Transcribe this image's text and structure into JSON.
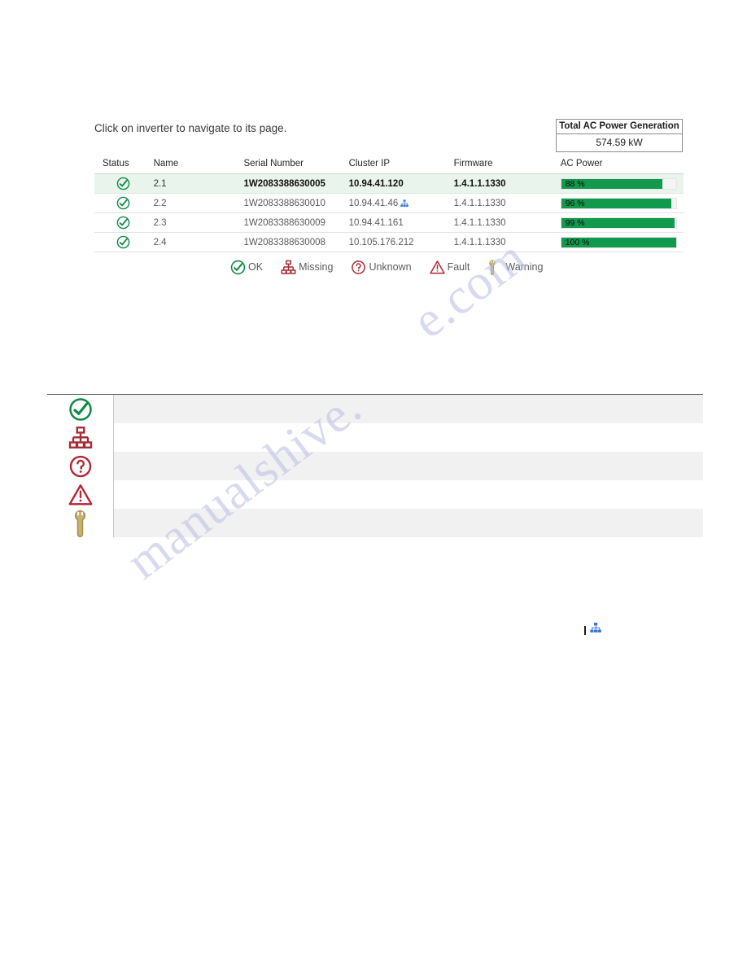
{
  "page": {
    "intro_text": "Click on inverter to navigate to its page.",
    "watermark_a": "manualshive.",
    "watermark_b": "e.com"
  },
  "total_panel": {
    "title": "Total AC Power Generation",
    "value": "574.59 kW"
  },
  "inverter_table": {
    "columns": [
      {
        "key": "status",
        "label": "Status"
      },
      {
        "key": "name",
        "label": "Name"
      },
      {
        "key": "serial",
        "label": "Serial Number"
      },
      {
        "key": "cluster_ip",
        "label": "Cluster IP"
      },
      {
        "key": "firmware",
        "label": "Firmware"
      },
      {
        "key": "ac_power",
        "label": "AC Power"
      }
    ],
    "rows": [
      {
        "status_icon": "ok-check-icon",
        "name": "2.1",
        "serial": "1W2083388630005",
        "cluster_ip": "10.94.41.120",
        "has_cluster_icon": false,
        "firmware": "1.4.1.1.1330",
        "ac_power_label": "88 %",
        "ac_power_percent": 88,
        "selected": true
      },
      {
        "status_icon": "ok-check-icon",
        "name": "2.2",
        "serial": "1W2083388630010",
        "cluster_ip": "10.94.41.46",
        "has_cluster_icon": true,
        "firmware": "1.4.1.1.1330",
        "ac_power_label": "96 %",
        "ac_power_percent": 96,
        "selected": false
      },
      {
        "status_icon": "ok-check-icon",
        "name": "2.3",
        "serial": "1W2083388630009",
        "cluster_ip": "10.94.41.161",
        "has_cluster_icon": false,
        "firmware": "1.4.1.1.1330",
        "ac_power_label": "99 %",
        "ac_power_percent": 99,
        "selected": false
      },
      {
        "status_icon": "ok-check-icon",
        "name": "2.4",
        "serial": "1W2083388630008",
        "cluster_ip": "10.105.176.212",
        "has_cluster_icon": false,
        "firmware": "1.4.1.1.1330",
        "ac_power_label": "100 %",
        "ac_power_percent": 100,
        "selected": false
      }
    ]
  },
  "legend": {
    "items": [
      {
        "icon": "ok-check-icon",
        "label": "OK"
      },
      {
        "icon": "missing-network-icon",
        "label": "Missing"
      },
      {
        "icon": "unknown-question-icon",
        "label": "Unknown"
      },
      {
        "icon": "fault-warning-triangle-icon",
        "label": "Fault"
      },
      {
        "icon": "warning-wrench-icon",
        "label": "Warning"
      }
    ]
  },
  "reference_table": {
    "rows": [
      {
        "icon": "ok-check-icon",
        "description": ""
      },
      {
        "icon": "missing-network-icon",
        "description": ""
      },
      {
        "icon": "unknown-question-icon",
        "description": ""
      },
      {
        "icon": "fault-warning-triangle-icon",
        "description": ""
      },
      {
        "icon": "warning-wrench-icon",
        "description": ""
      }
    ]
  },
  "inline_note": {
    "icon": "cluster-network-icon"
  },
  "colors": {
    "ok_green": "#0f8a45",
    "bar_green": "#11994d",
    "selected_row": "#e9f5ec",
    "missing_red": "#a62b35",
    "fault_red": "#b32633",
    "warning_tan": "#b49a52",
    "cluster_blue": "#3b78d8",
    "shade_gray": "#f1f1f1"
  }
}
